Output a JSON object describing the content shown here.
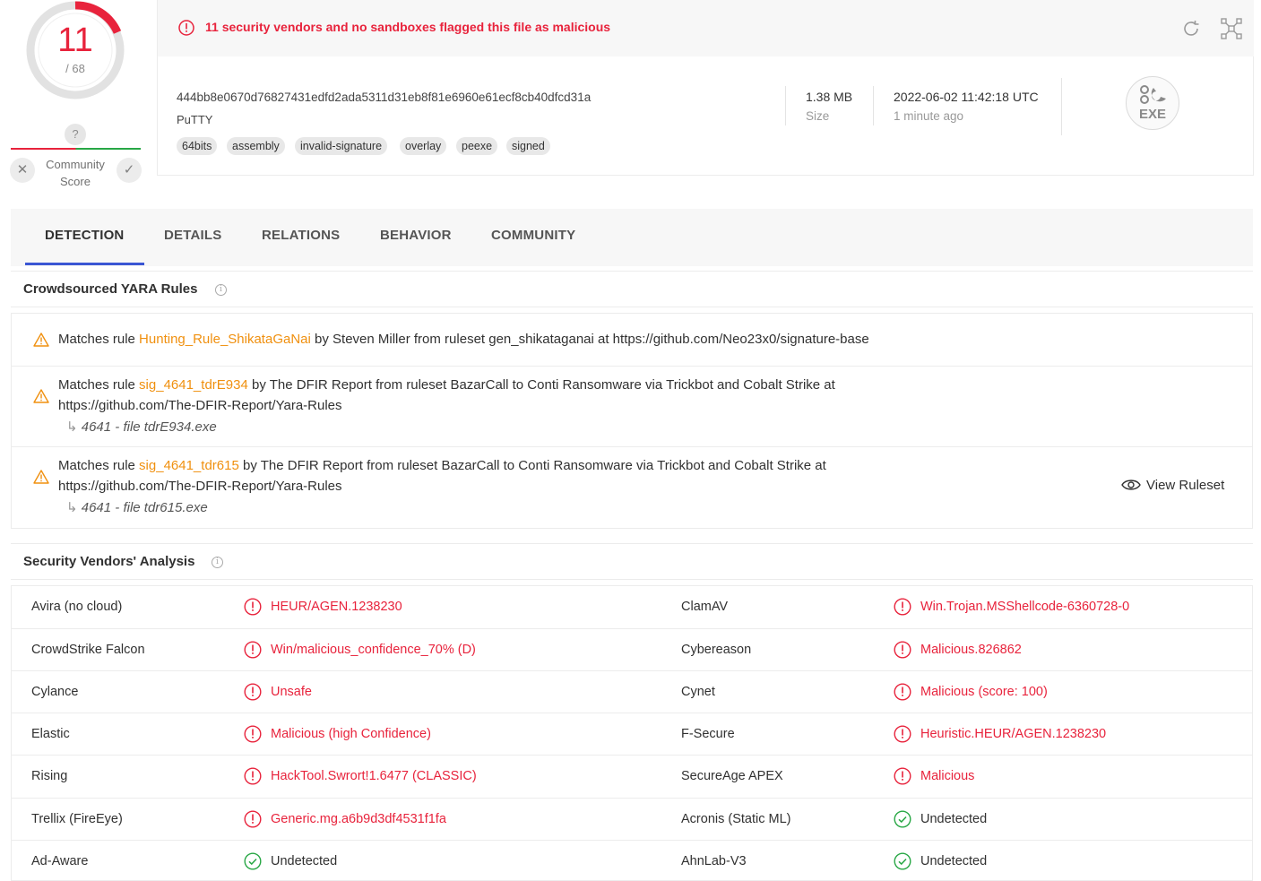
{
  "score": {
    "detections": "11",
    "total": "/ 68",
    "community_question": "?",
    "community_label_line1": "Community",
    "community_label_line2": "Score"
  },
  "header": {
    "alert": "11 security vendors and no sandboxes flagged this file as malicious",
    "hash": "444bb8e0670d76827431edfd2ada5311d31eb8f81e6960e61ecf8cb40dfcd31a",
    "file_name": "PuTTY",
    "tags": [
      "64bits",
      "assembly",
      "invalid-signature",
      "overlay",
      "peexe",
      "signed"
    ],
    "size_value": "1.38 MB",
    "size_label": "Size",
    "date_value": "2022-06-02 11:42:18 UTC",
    "date_ago": "1 minute ago",
    "file_type": "EXE"
  },
  "tabs": [
    "DETECTION",
    "DETAILS",
    "RELATIONS",
    "BEHAVIOR",
    "COMMUNITY"
  ],
  "yara": {
    "title": "Crowdsourced YARA Rules",
    "rules": [
      {
        "prefix": "Matches rule ",
        "rule": "Hunting_Rule_ShikataGaNai",
        "line1": " by Steven Miller from ruleset gen_shikataganai at https://github.com/Neo23x0/signature-base",
        "line2": "",
        "sub": ""
      },
      {
        "prefix": "Matches rule ",
        "rule": "sig_4641_tdrE934",
        "line1": " by The DFIR Report from ruleset BazarCall to Conti Ransomware via Trickbot and Cobalt Strike at",
        "line2": "https://github.com/The-DFIR-Report/Yara-Rules",
        "sub": "4641 - file tdrE934.exe"
      },
      {
        "prefix": "Matches rule ",
        "rule": "sig_4641_tdr615",
        "line1": " by The DFIR Report from ruleset BazarCall to Conti Ransomware via Trickbot and Cobalt Strike at",
        "line2": "https://github.com/The-DFIR-Report/Yara-Rules",
        "sub": "4641 - file tdr615.exe"
      }
    ],
    "view_ruleset": "View Ruleset"
  },
  "vendors": {
    "title": "Security Vendors' Analysis",
    "rows": [
      {
        "left_name": "Avira (no cloud)",
        "left_result": "HEUR/AGEN.1238230",
        "left_status": "malicious",
        "right_name": "ClamAV",
        "right_result": "Win.Trojan.MSShellcode-6360728-0",
        "right_status": "malicious"
      },
      {
        "left_name": "CrowdStrike Falcon",
        "left_result": "Win/malicious_confidence_70% (D)",
        "left_status": "malicious",
        "right_name": "Cybereason",
        "right_result": "Malicious.826862",
        "right_status": "malicious"
      },
      {
        "left_name": "Cylance",
        "left_result": "Unsafe",
        "left_status": "malicious",
        "right_name": "Cynet",
        "right_result": "Malicious (score: 100)",
        "right_status": "malicious"
      },
      {
        "left_name": "Elastic",
        "left_result": "Malicious (high Confidence)",
        "left_status": "malicious",
        "right_name": "F-Secure",
        "right_result": "Heuristic.HEUR/AGEN.1238230",
        "right_status": "malicious"
      },
      {
        "left_name": "Rising",
        "left_result": "HackTool.Swrort!1.6477 (CLASSIC)",
        "left_status": "malicious",
        "right_name": "SecureAge APEX",
        "right_result": "Malicious",
        "right_status": "malicious"
      },
      {
        "left_name": "Trellix (FireEye)",
        "left_result": "Generic.mg.a6b9d3df4531f1fa",
        "left_status": "malicious",
        "right_name": "Acronis (Static ML)",
        "right_result": "Undetected",
        "right_status": "undetected"
      },
      {
        "left_name": "Ad-Aware",
        "left_result": "Undetected",
        "left_status": "undetected",
        "right_name": "AhnLab-V3",
        "right_result": "Undetected",
        "right_status": "undetected"
      }
    ]
  },
  "colors": {
    "malicious": "#e8233c",
    "undetected": "#28a745",
    "yara_link": "#f0900f",
    "tab_active": "#3b56d4"
  }
}
